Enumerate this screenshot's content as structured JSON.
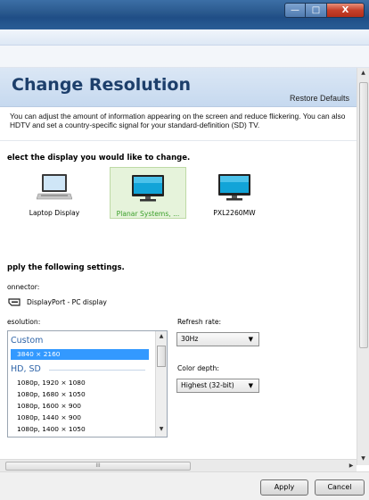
{
  "window": {
    "minimize": "—",
    "maximize": "□",
    "close": "X"
  },
  "header": {
    "title": "Change Resolution",
    "restore_defaults": "Restore Defaults"
  },
  "description": {
    "line1": "You can adjust the amount of information appearing on the screen and reduce flickering. You can also",
    "line2": "HDTV and set a country-specific signal for your standard-definition (SD) TV."
  },
  "select_display": {
    "heading": "elect the display you would like to change.",
    "displays": [
      {
        "label": "Laptop Display",
        "icon": "laptop-icon",
        "selected": false
      },
      {
        "label": "Planar Systems, ...",
        "icon": "monitor-icon",
        "selected": true
      },
      {
        "label": "PXL2260MW",
        "icon": "monitor-icon",
        "selected": false
      }
    ]
  },
  "settings": {
    "heading": "pply the following settings.",
    "connector_label": "onnector:",
    "connector_value": "DisplayPort - PC display",
    "connector_icon": "displayport-icon",
    "resolution_label": "esolution:",
    "refresh_label": "Refresh rate:",
    "refresh_value": "30Hz",
    "depth_label": "Color depth:",
    "depth_value": "Highest (32-bit)"
  },
  "resolution_list": {
    "group_custom": "Custom",
    "custom_items": [
      "3840 × 2160"
    ],
    "group_hdsd": "HD, SD",
    "hd_items": [
      "1080p, 1920 × 1080",
      "1080p, 1680 × 1050",
      "1080p, 1600 × 900",
      "1080p, 1440 × 900",
      "1080p, 1400 × 1050"
    ]
  },
  "scrollbar": {
    "grip": "III",
    "up": "▲",
    "down": "▼",
    "left": "◀",
    "right": "▶"
  },
  "footer": {
    "apply": "Apply",
    "cancel": "Cancel"
  },
  "colors": {
    "accent": "#3399ff",
    "selected_display": "#3a9f2a",
    "title": "#1d3f6b"
  }
}
